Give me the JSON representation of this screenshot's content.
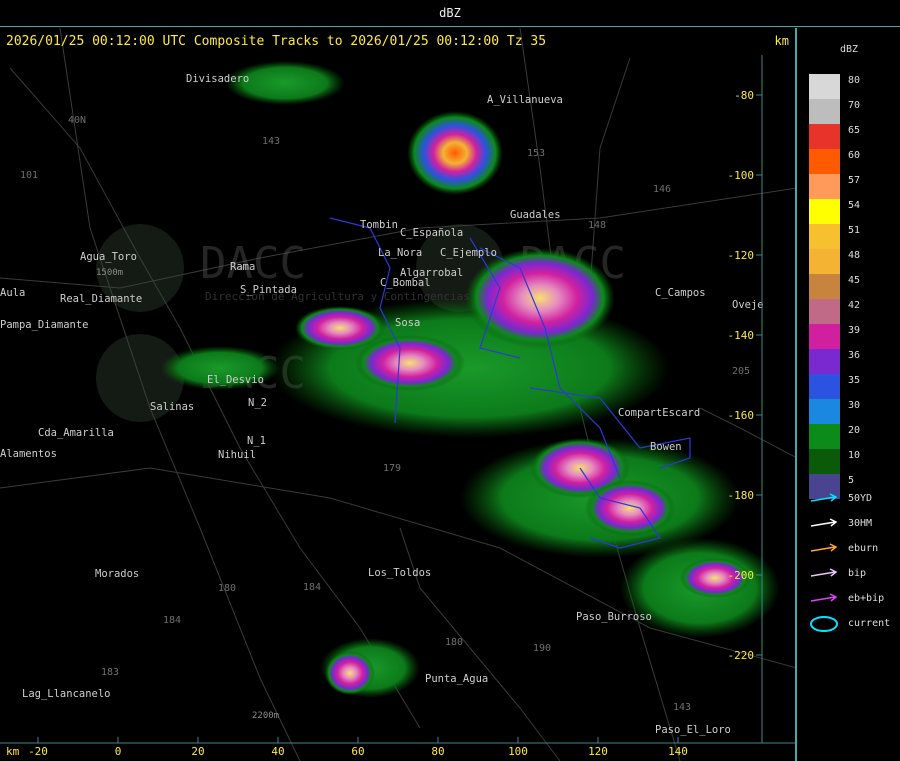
{
  "window": {
    "title": "dBZ"
  },
  "map": {
    "header": "2026/01/25 00:12:00 UTC Composite Tracks to 2026/01/25 00:12:00 Tz 35",
    "km_label": "km",
    "x_axis_label": "km",
    "x_ticks": [
      "-20",
      "0",
      "20",
      "40",
      "60",
      "80",
      "100",
      "120",
      "140"
    ],
    "y_ticks": [
      "-80",
      "-100",
      "-120",
      "-140",
      "-160",
      "-180",
      "-200",
      "-220"
    ],
    "places": [
      "Divisadero",
      "A_Villanueva",
      "Guadales",
      "Tombin",
      "C_Española",
      "C_Ejemplo",
      "Rama",
      "S_Pintada",
      "Pampa_Diamante",
      "Sosa",
      "Salinas",
      "El_Desvio",
      "Cda_Amarilla",
      "Nihuil",
      "N_1",
      "N_2",
      "Morados",
      "Los_Toldos",
      "Paso_Burroso",
      "Punta_Agua",
      "Lag_Llancanelo",
      "Paso_El_Loro",
      "C_Campos",
      "CompartEscard",
      "Bowen",
      "La_Nora",
      "C_Bombal",
      "Algarrobal",
      "Oveje",
      "Alamentos",
      "Agua_Toro",
      "Real_Diamante",
      "Aula"
    ],
    "road_numbers": [
      "143",
      "153",
      "146",
      "148",
      "101",
      "40N",
      "179",
      "180",
      "184",
      "184",
      "183",
      "190",
      "143",
      "205",
      "180"
    ],
    "watermark": "DACC",
    "watermark_sub": "Direccion de Agricultura y Contingencias Climaticas",
    "elevation_labels": [
      "1500m",
      "2200m"
    ]
  },
  "legend": {
    "title": "dBZ",
    "scale": [
      {
        "label": "80",
        "color": "#d8d8d8"
      },
      {
        "label": "70",
        "color": "#bdbdbd"
      },
      {
        "label": "65",
        "color": "#e8332a"
      },
      {
        "label": "60",
        "color": "#ff5a00"
      },
      {
        "label": "57",
        "color": "#ff9a5a"
      },
      {
        "label": "54",
        "color": "#ffff00"
      },
      {
        "label": "51",
        "color": "#f6c02e"
      },
      {
        "label": "48",
        "color": "#f4b332"
      },
      {
        "label": "45",
        "color": "#c8843f"
      },
      {
        "label": "42",
        "color": "#c06a88"
      },
      {
        "label": "39",
        "color": "#d020a0"
      },
      {
        "label": "36",
        "color": "#7a28d0"
      },
      {
        "label": "35",
        "color": "#2c52e0"
      },
      {
        "label": "30",
        "color": "#1a88e0"
      },
      {
        "label": "20",
        "color": "#0c8a1a"
      },
      {
        "label": "10",
        "color": "#0a5a0a"
      },
      {
        "label": "5",
        "color": "#4a4490"
      }
    ],
    "tracks": [
      {
        "label": "50YD",
        "color": "#00e5ff"
      },
      {
        "label": "30HM",
        "color": "#ffffff"
      },
      {
        "label": "eburn",
        "color": "#ffa726"
      },
      {
        "label": "bip",
        "color": "#f5c0ff"
      },
      {
        "label": "eb+bip",
        "color": "#e040fb"
      },
      {
        "label": "current",
        "color": "#00e5ff"
      }
    ]
  }
}
